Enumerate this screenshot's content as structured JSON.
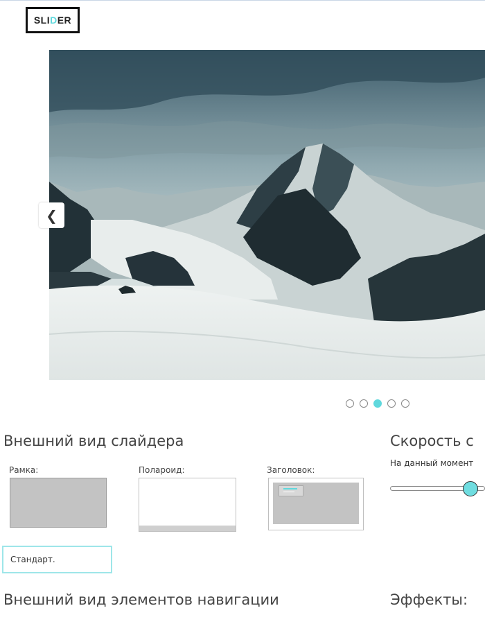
{
  "logo": {
    "text_before": "SLI",
    "text_accent": "D",
    "text_after": "ER"
  },
  "slider": {
    "prev_glyph": "❮",
    "dots_total": 5,
    "active_dot": 3
  },
  "appearance": {
    "heading": "Внешний вид слайдера",
    "options": {
      "frame_label": "Рамка:",
      "polaroid_label": "Полароид:",
      "title_label": "Заголовок:"
    },
    "standard_button": "Стандарт."
  },
  "speed": {
    "heading": "Скорость с",
    "description": "На данный момент",
    "slider_value_fraction": 0.85
  },
  "navigation_heading": "Внешний вид элементов навигации",
  "effects_heading": "Эффекты:",
  "colors": {
    "accent": "#5fd8dd",
    "text": "#444444"
  },
  "icons": {
    "prev": "chevron-left-icon"
  }
}
